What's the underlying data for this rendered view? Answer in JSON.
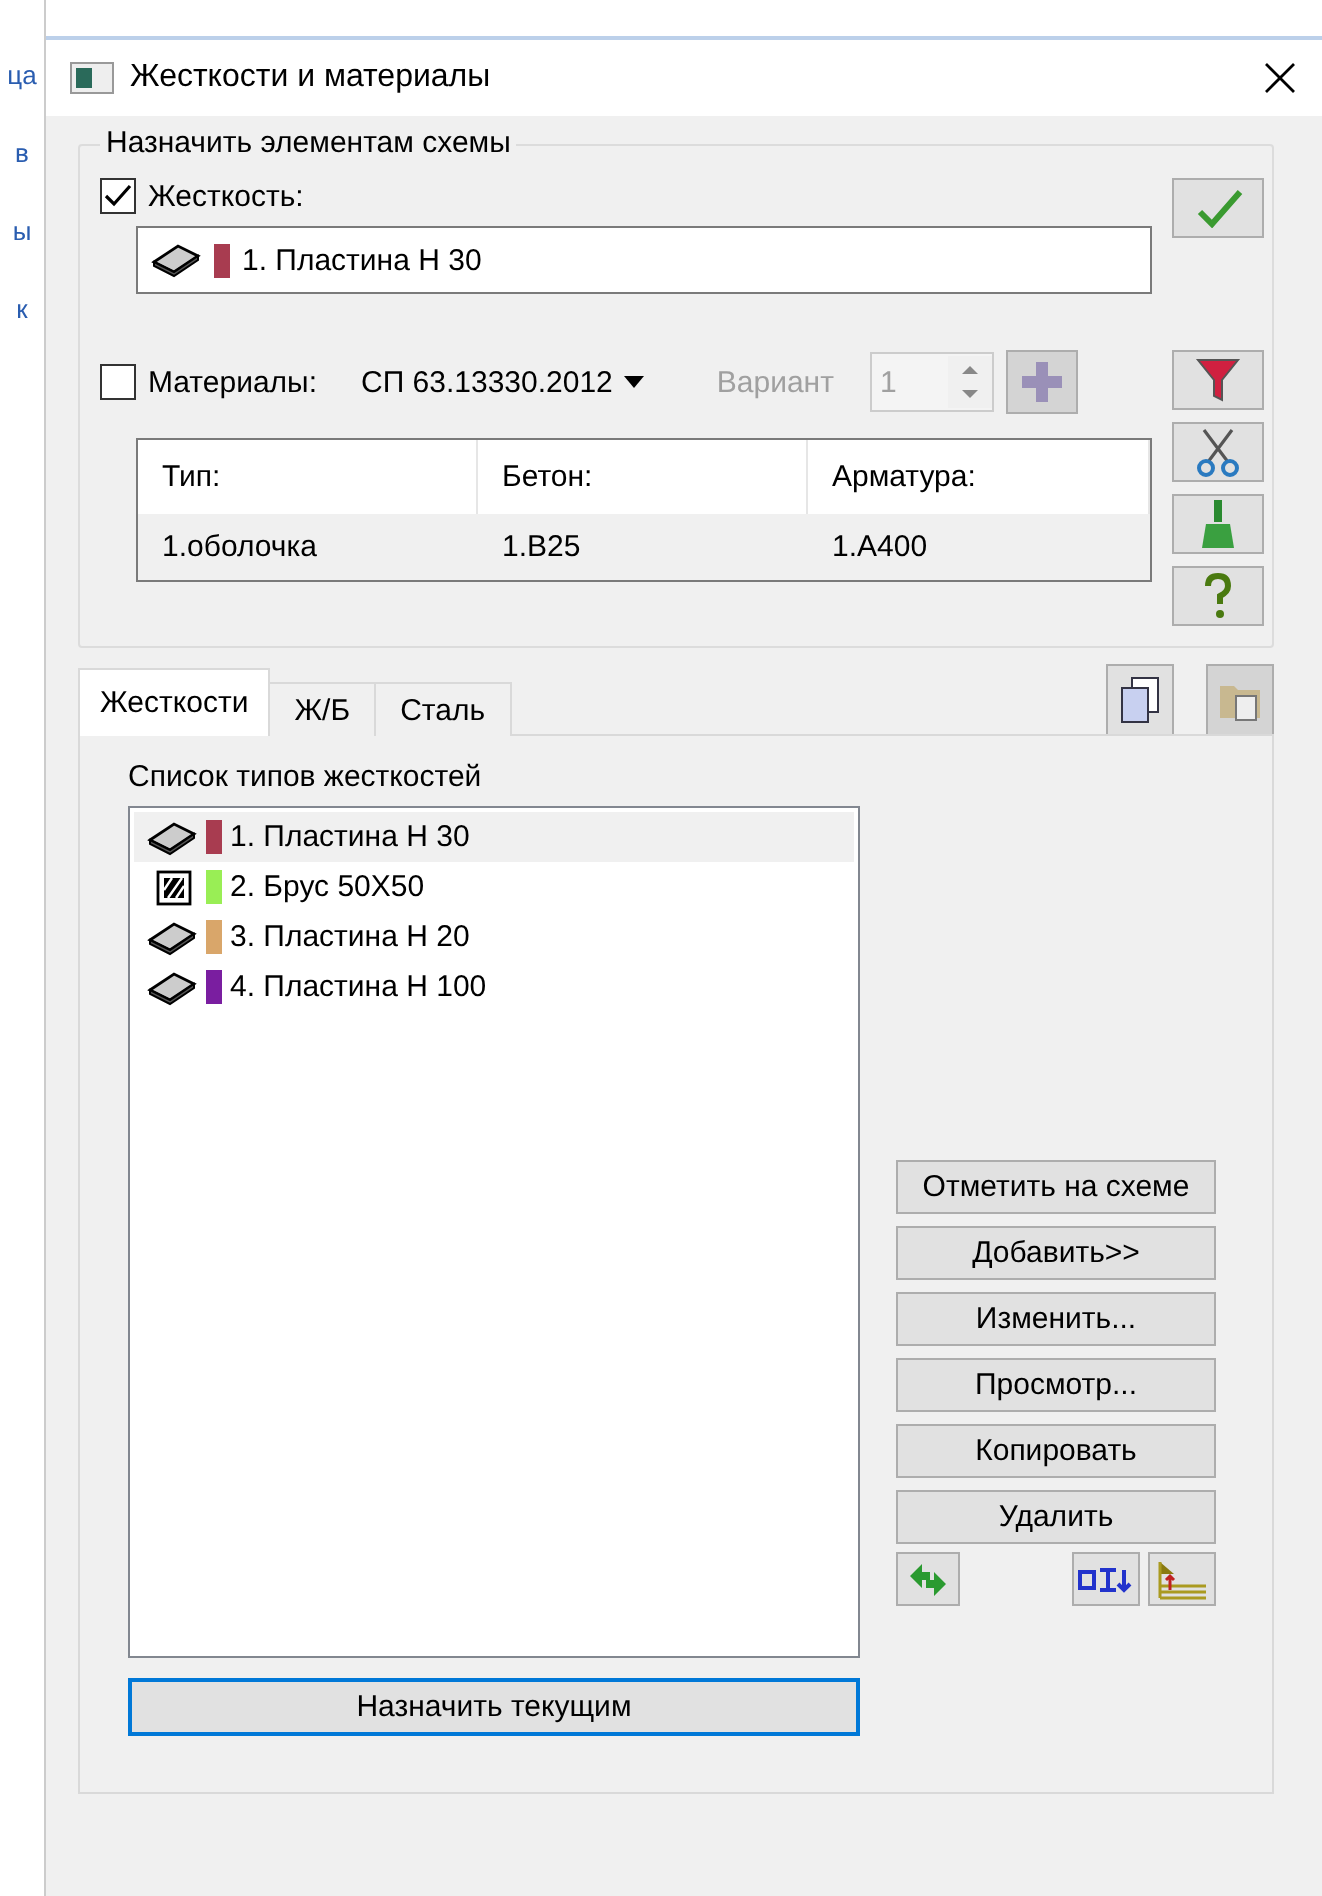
{
  "background_window": {
    "texts": [
      "ца",
      "в",
      "ы",
      "к"
    ]
  },
  "window": {
    "title": "Жесткости и материалы"
  },
  "assign_group": {
    "legend": "Назначить элементам схемы",
    "stiffness": {
      "label": "Жесткость:",
      "checked": true
    },
    "current_stiffness": {
      "text": "1. Пластина  Н 30",
      "kind": "plate",
      "color": "#a83c50"
    },
    "materials": {
      "label": "Материалы:",
      "checked": false,
      "standard": "СП 63.13330.2012",
      "variant_label": "Вариант",
      "variant_value": "1",
      "disabled": true
    },
    "table": {
      "columns": [
        "Тип:",
        "Бетон:",
        "Арматура:"
      ],
      "rows": [
        [
          "1.оболочка",
          "1.В25",
          "1.А400"
        ]
      ]
    }
  },
  "tabs": [
    {
      "label": "Жесткости",
      "selected": true
    },
    {
      "label": "Ж/Б",
      "selected": false
    },
    {
      "label": "Сталь",
      "selected": false
    }
  ],
  "stiffness_list": {
    "label": "Список типов жесткостей",
    "items": [
      {
        "text": "1. Пластина  Н 30",
        "kind": "plate",
        "color": "#a83c50",
        "selected": true
      },
      {
        "text": "2. Брус 50Х50",
        "kind": "beam",
        "color": "#99ee55",
        "selected": false
      },
      {
        "text": "3. Пластина  Н 20",
        "kind": "plate",
        "color": "#d9a66a",
        "selected": false
      },
      {
        "text": "4. Пластина  Н 100",
        "kind": "plate",
        "color": "#7a1ea0",
        "selected": false
      }
    ]
  },
  "actions": [
    "Отметить на схеме",
    "Добавить>>",
    "Изменить...",
    "Просмотр...",
    "Копировать",
    "Удалить"
  ],
  "assign_current_button": "Назначить текущим"
}
